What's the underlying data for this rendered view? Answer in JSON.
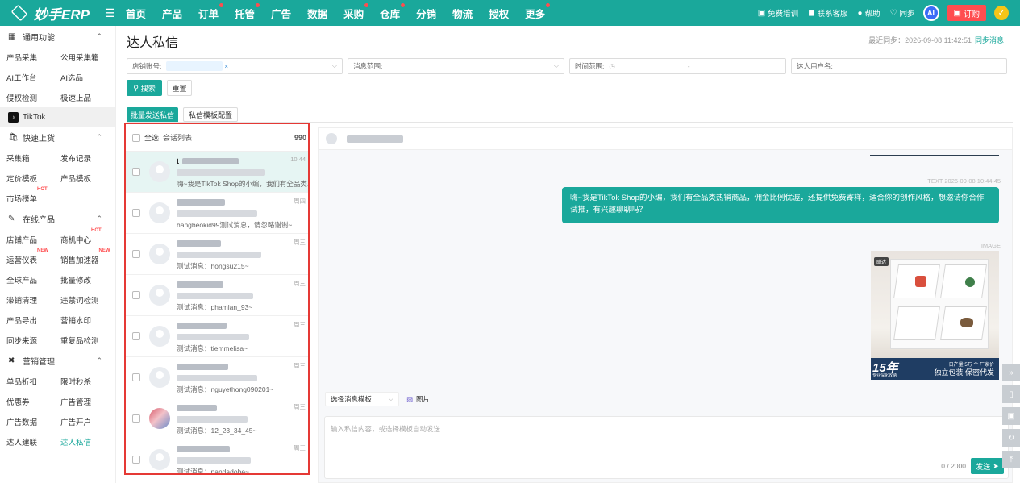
{
  "app": {
    "logo_text": "妙手ERP",
    "menu_icon": "hamburger-icon"
  },
  "nav": [
    {
      "label": "首页",
      "dot": false
    },
    {
      "label": "产品",
      "dot": false
    },
    {
      "label": "订单",
      "dot": true
    },
    {
      "label": "托管",
      "dot": true
    },
    {
      "label": "广告",
      "dot": false
    },
    {
      "label": "数据",
      "dot": false
    },
    {
      "label": "采购",
      "dot": true
    },
    {
      "label": "仓库",
      "dot": true
    },
    {
      "label": "分销",
      "dot": false
    },
    {
      "label": "物流",
      "dot": false
    },
    {
      "label": "授权",
      "dot": false
    },
    {
      "label": "更多",
      "dot": true
    }
  ],
  "top_right": {
    "training": "免费培训",
    "service": "联系客服",
    "help": "帮助",
    "sync": "同步",
    "ai": "AI",
    "order_btn": "订购"
  },
  "sidebar": {
    "group_common": "通用功能",
    "common_items": [
      [
        "产品采集",
        "公用采集箱"
      ],
      [
        "AI工作台",
        "AI选品"
      ],
      [
        "侵权检测",
        "极速上品"
      ]
    ],
    "platform": "TikTok",
    "group_quick": "快速上货",
    "quick_items": [
      [
        "采集箱",
        "发布记录"
      ],
      [
        "定价模板",
        "产品模板"
      ],
      [
        "市场榜单",
        ""
      ]
    ],
    "group_online": "在线产品",
    "online_items": [
      [
        "店铺产品",
        "商机中心"
      ],
      [
        "运营仪表",
        "销售加速器"
      ],
      [
        "全球产品",
        "批量修改"
      ],
      [
        "滞销清理",
        "违禁词检测"
      ],
      [
        "产品导出",
        "营销水印"
      ],
      [
        "同步来源",
        "重复品检测"
      ]
    ],
    "group_marketing": "营销管理",
    "marketing_items": [
      [
        "单品折扣",
        "限时秒杀"
      ],
      [
        "优惠券",
        "广告管理"
      ],
      [
        "广告数据",
        "广告开户"
      ],
      [
        "达人建联",
        "达人私信"
      ]
    ],
    "badge_hot": "HOT",
    "badge_new": "NEW"
  },
  "page": {
    "title": "达人私信",
    "last_sync_label": "最近同步：2026-09-08 11:42:51",
    "sync_link": "同步消息"
  },
  "filters": {
    "store_label": "店铺账号:",
    "store_tag": "",
    "msg_range_label": "消息范围:",
    "time_range_label": "时间范围:",
    "time_sep": "-",
    "creator_label": "达人用户名:"
  },
  "buttons": {
    "search": "搜索",
    "reset": "重置",
    "batch_send": "批量发送私信",
    "template_config": "私信模板配置",
    "send": "发送"
  },
  "conversations": {
    "select_all": "全选",
    "list_title": "会话列表",
    "count": "990",
    "items": [
      {
        "name": "t",
        "msg": "嗨~我是TikTok Shop的小编，我们有全品类...",
        "time": "10:44",
        "selected": true,
        "avatar": "plain"
      },
      {
        "name": "",
        "msg": "hangbeokid99测试消息，请忽略谢谢~",
        "time": "周四",
        "selected": false,
        "avatar": "plain"
      },
      {
        "name": "",
        "msg": "测试消息：hongsu215~",
        "time": "周三",
        "selected": false,
        "avatar": "plain"
      },
      {
        "name": "",
        "msg": "测试消息：phamlan_93~",
        "time": "周三",
        "selected": false,
        "avatar": "plain"
      },
      {
        "name": "",
        "msg": "测试消息：tiemmelisa~",
        "time": "周三",
        "selected": false,
        "avatar": "plain"
      },
      {
        "name": "",
        "msg": "测试消息：nguyethong090201~",
        "time": "周三",
        "selected": false,
        "avatar": "plain"
      },
      {
        "name": "",
        "msg": "测试消息：12_23_34_45~",
        "time": "周三",
        "selected": false,
        "avatar": "photo"
      },
      {
        "name": "",
        "msg": "测试消息：pandadobe~",
        "time": "周三",
        "selected": false,
        "avatar": "plain"
      }
    ]
  },
  "chat": {
    "msg1_meta": "TEXT 2026-09-08 10:44:45",
    "msg1_text": "嗨~我是TikTok Shop的小编，我们有全品类热销商品，佣金比例优渥，还提供免费寄样，适合你的创作风格，想邀请你合作试推，有兴趣聊聊吗？",
    "msg2_meta": "IMAGE",
    "image": {
      "tag": "联达",
      "big": "15年",
      "sub": "专业深化收纳",
      "right1": "日产量 5万 个 厂家价",
      "right2": "独立包装  保密代发"
    },
    "template_select": "选择消息模板",
    "image_btn": "图片",
    "input_placeholder": "输入私信内容，或选择模板自动发送",
    "char_count": "0 / 2000"
  },
  "colors": {
    "brand": "#1aa89b",
    "danger": "#ff4d4f",
    "highlight_border": "#e53935"
  }
}
